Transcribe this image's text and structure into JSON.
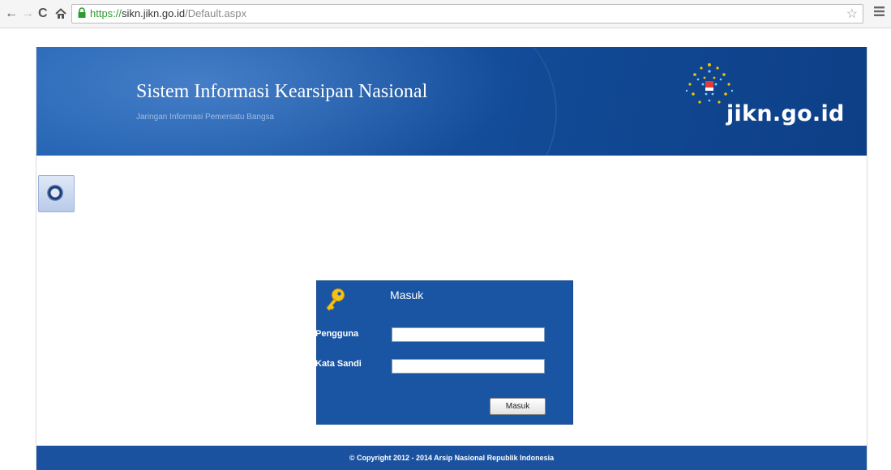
{
  "browser": {
    "url": {
      "scheme": "https",
      "separator": "://",
      "host": "sikn.jikn.go.id",
      "path": "/Default.aspx"
    },
    "icons": {
      "back": "back-arrow-icon",
      "forward": "forward-arrow-icon",
      "reload": "reload-icon",
      "home": "home-icon",
      "secure": "lock-icon",
      "bookmark": "star-icon",
      "menu": "menu-icon"
    }
  },
  "header": {
    "title": "Sistem Informasi Kearsipan Nasional",
    "subtitle": "Jaringan Informasi Pemersatu Bangsa",
    "logo_text": "jikn.go.id",
    "background_color": "#1a57a6"
  },
  "login": {
    "title": "Masuk",
    "username_label": "Pengguna",
    "username_value": "",
    "password_label": "Kata Sandi",
    "password_value": "",
    "submit_label": "Masuk",
    "panel_color": "#1a55a3"
  },
  "footer": {
    "copyright": "© Copyright 2012 - 2014 Arsip Nasional Republik Indonesia"
  }
}
